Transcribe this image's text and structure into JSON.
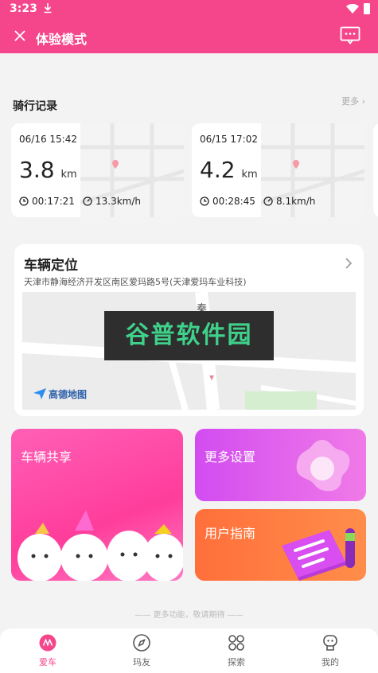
{
  "status": {
    "time": "3:23"
  },
  "header": {
    "title": "体验模式"
  },
  "ride_section": {
    "title": "骑行记录",
    "more": "更多"
  },
  "rides": [
    {
      "date": "06/16 15:42",
      "distance": "3.8",
      "unit": "km",
      "duration": "00:17:21",
      "speed": "13.3km/h"
    },
    {
      "date": "06/15 17:02",
      "distance": "4.2",
      "unit": "km",
      "duration": "00:28:45",
      "speed": "8.1km/h"
    }
  ],
  "location": {
    "title": "车辆定位",
    "address": "天津市静海经济开发区南区爱玛路5号(天津爱玛车业科技)",
    "map_logo": "高德地图",
    "map_label": "秦"
  },
  "watermark": "谷普软件园",
  "tiles": {
    "share": "车辆共享",
    "settings": "更多设置",
    "guide": "用户指南"
  },
  "footer_note": "—— 更多功能，敬请期待 ——",
  "nav": [
    {
      "label": "爱车"
    },
    {
      "label": "玛友"
    },
    {
      "label": "探索"
    },
    {
      "label": "我的"
    }
  ],
  "colors": {
    "brand": "#f5468c",
    "share_tile": "#ff3d9b",
    "settings_tile": "#d24cf0",
    "guide_tile": "#ff6f3b"
  }
}
